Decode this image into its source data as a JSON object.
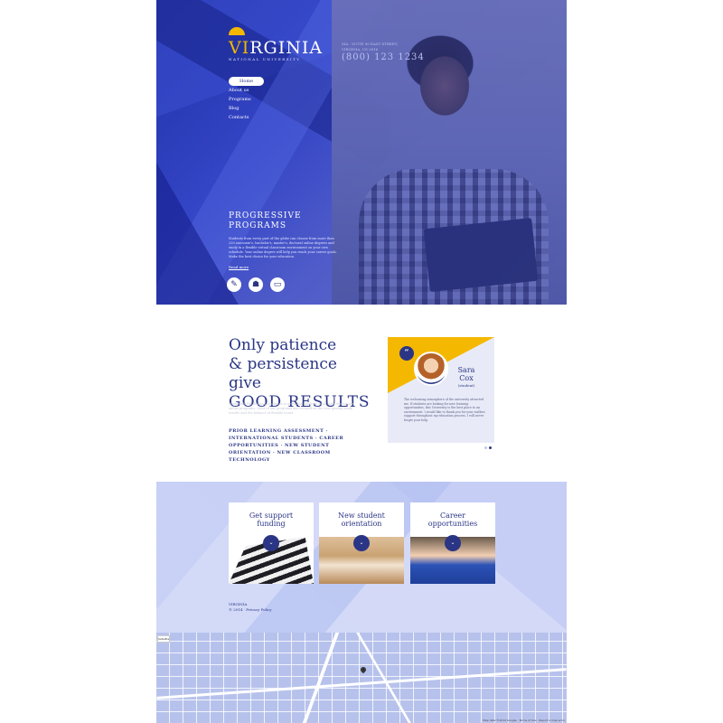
{
  "brand": {
    "name_highlight": "VI",
    "name_rest": "RGINIA",
    "subtitle": "NATIONAL UNIVERSITY",
    "address": "ZIA - SUITE 90 EAST STREET, VIRGINIA, US 9016",
    "phone": "(800) 123 1234"
  },
  "nav": {
    "items": [
      "Home",
      "About us",
      "Programs",
      "Blog",
      "Contacts"
    ]
  },
  "hero": {
    "heading": "PROGRESSIVE PROGRAMS",
    "paragraph": "Students from every part of the globe can choose from more than 220 associate's, bachelor's, master's, doctoral online degrees and study in a flexible virtual classroom environment on your own schedule. Your online degree will help you reach your career goals. Make the best choice for your education.",
    "read_more": "Read more",
    "icons": [
      "book-icon",
      "people-icon",
      "laptop-icon"
    ]
  },
  "quote_section": {
    "heading_line1": "Only patience",
    "heading_line2": "& persistence give",
    "heading_line3": "GOOD RESULTS",
    "body": "Worldwide the demand continues to grow and students of all ages choose our online programs. Most of our programs are focused on the best quality study results and the balance of flexible hours.",
    "links": "PRIOR LEARNING ASSESSMENT · INTERNATIONAL STUDENTS · CAREER OPPORTUNITIES · NEW STUDENT ORIENTATION · NEW CLASSROOM TECHNOLOGY"
  },
  "testimonial": {
    "quote_mark": "“",
    "name_line1": "Sara",
    "name_line2": "Cox",
    "role": "(student)",
    "text": "The welcoming atmosphere of the university attracted me. If students are looking for new learning opportunities, this University is the best place to an environment. I would like to thank you for your endless support throughout my education process. I will never forget your help."
  },
  "services": [
    {
      "title_line1": "Get support",
      "title_line2": "funding",
      "button": "⌄"
    },
    {
      "title_line1": "New student",
      "title_line2": "orientation",
      "button": "⌄"
    },
    {
      "title_line1": "Career",
      "title_line2": "opportunities",
      "button": "⌄"
    }
  ],
  "footer": {
    "brand": "VIRGINIA",
    "copyright": "© 2014 · Privacy Policy"
  },
  "map": {
    "control_label": "Satellite",
    "credit": "Map data ©2014 Google · Terms of Use · Report a map error"
  },
  "colors": {
    "primary": "#2a3585",
    "accent": "#f5b800",
    "hero_blue": "#3445c6"
  }
}
